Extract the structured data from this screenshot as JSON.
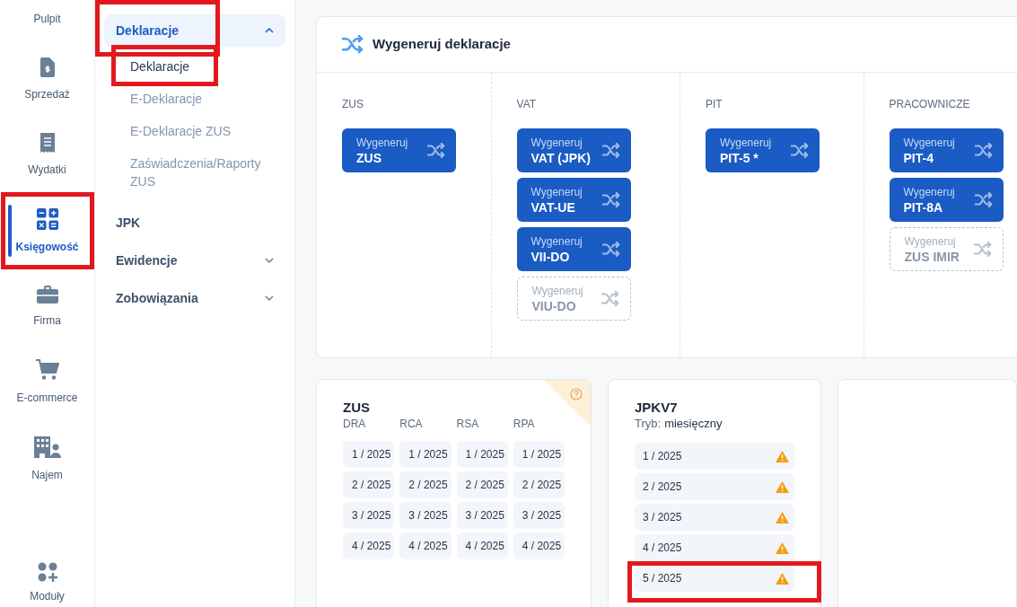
{
  "rail": [
    {
      "kind": "none",
      "label": "Pulpit",
      "selected": false,
      "highlighted": false
    },
    {
      "kind": "invoice",
      "label": "Sprzedaż",
      "selected": false,
      "highlighted": false
    },
    {
      "kind": "receipt",
      "label": "Wydatki",
      "selected": false,
      "highlighted": false
    },
    {
      "kind": "calculator",
      "label": "Księgowość",
      "selected": true,
      "highlighted": true
    },
    {
      "kind": "briefcase",
      "label": "Firma",
      "selected": false,
      "highlighted": false
    },
    {
      "kind": "cart",
      "label": "E-commerce",
      "selected": false,
      "highlighted": false
    },
    {
      "kind": "building",
      "label": "Najem",
      "selected": false,
      "highlighted": false
    }
  ],
  "rail_bottom": {
    "kind": "modules",
    "label": "Moduły"
  },
  "menu": [
    {
      "label": "Deklaracje",
      "expanded": true,
      "has_toggle": true,
      "highlighted": true,
      "children": [
        {
          "label": "Deklaracje",
          "selected": true,
          "highlighted": true
        },
        {
          "label": "E-Deklaracje",
          "selected": false,
          "highlighted": false
        },
        {
          "label": "E-Deklaracje ZUS",
          "selected": false,
          "highlighted": false
        },
        {
          "label": "Zaświadczenia/Raporty ZUS",
          "selected": false,
          "highlighted": false
        }
      ]
    },
    {
      "label": "JPK",
      "expanded": false,
      "has_toggle": false,
      "highlighted": false
    },
    {
      "label": "Ewidencje",
      "expanded": false,
      "has_toggle": true,
      "highlighted": false
    },
    {
      "label": "Zobowiązania",
      "expanded": false,
      "has_toggle": true,
      "highlighted": false
    }
  ],
  "generate": {
    "title": "Wygeneruj deklaracje",
    "columns": [
      {
        "heading": "ZUS",
        "buttons": [
          {
            "action": "Wygeneruj",
            "name": "ZUS",
            "disabled": false
          }
        ]
      },
      {
        "heading": "VAT",
        "buttons": [
          {
            "action": "Wygeneruj",
            "name": "VAT (JPK)",
            "disabled": false
          },
          {
            "action": "Wygeneruj",
            "name": "VAT-UE",
            "disabled": false
          },
          {
            "action": "Wygeneruj",
            "name": "VII-DO",
            "disabled": false
          },
          {
            "action": "Wygeneruj",
            "name": "VIU-DO",
            "disabled": true
          }
        ]
      },
      {
        "heading": "PIT",
        "buttons": [
          {
            "action": "Wygeneruj",
            "name": "PIT-5 *",
            "disabled": false
          }
        ]
      },
      {
        "heading": "PRACOWNICZE",
        "buttons": [
          {
            "action": "Wygeneruj",
            "name": "PIT-4",
            "disabled": false
          },
          {
            "action": "Wygeneruj",
            "name": "PIT-8A",
            "disabled": false
          },
          {
            "action": "Wygeneruj",
            "name": "ZUS IMIR",
            "disabled": true
          }
        ]
      }
    ]
  },
  "zus_card": {
    "title": "ZUS",
    "columns": [
      {
        "heading": "DRA",
        "periods": [
          "1 / 2025",
          "2 / 2025",
          "3 / 2025",
          "4 / 2025"
        ]
      },
      {
        "heading": "RCA",
        "periods": [
          "1 / 2025",
          "2 / 2025",
          "3 / 2025",
          "4 / 2025"
        ]
      },
      {
        "heading": "RSA",
        "periods": [
          "1 / 2025",
          "2 / 2025",
          "3 / 2025",
          "4 / 2025"
        ]
      },
      {
        "heading": "RPA",
        "periods": [
          "1 / 2025",
          "2 / 2025",
          "3 / 2025",
          "4 / 2025"
        ]
      }
    ]
  },
  "jpk_card": {
    "title": "JPKV7",
    "mode_label": "Tryb:",
    "mode_value": "miesięczny",
    "periods": [
      {
        "label": "1 / 2025",
        "warning": true,
        "highlighted": false
      },
      {
        "label": "2 / 2025",
        "warning": true,
        "highlighted": false
      },
      {
        "label": "3 / 2025",
        "warning": true,
        "highlighted": false
      },
      {
        "label": "4 / 2025",
        "warning": true,
        "highlighted": false
      },
      {
        "label": "5 / 2025",
        "warning": true,
        "highlighted": true
      }
    ]
  }
}
